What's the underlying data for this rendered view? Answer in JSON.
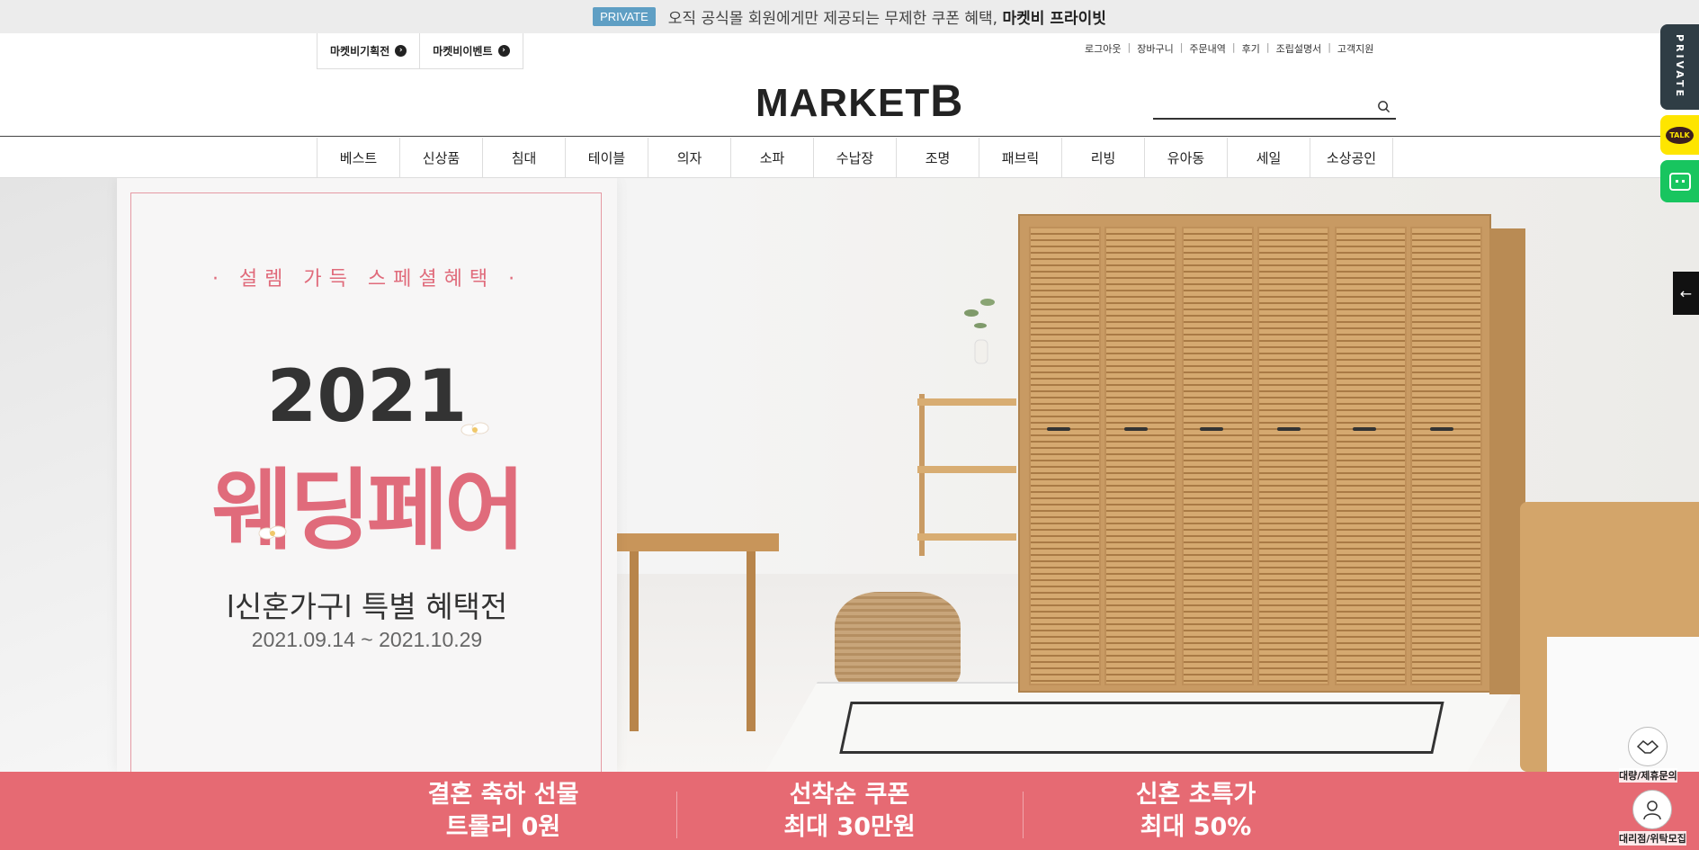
{
  "promo": {
    "badge": "PRIVATE",
    "text": "오직 공식몰 회원에게만 제공되는 무제한 쿠폰 혜택,",
    "brand": "마켓비 프라이빗"
  },
  "event_tabs": [
    {
      "label": "마켓비기획전",
      "icon": "arrow-right-circle-icon"
    },
    {
      "label": "마켓비이벤트",
      "icon": "arrow-right-circle-icon"
    }
  ],
  "util_links": [
    "로그아웃",
    "장바구니",
    "주문내역",
    "후기",
    "조립설명서",
    "고객지원"
  ],
  "logo": {
    "text": "MARKET",
    "suffix": "B"
  },
  "search": {
    "placeholder": "",
    "icon": "search-icon"
  },
  "nav": [
    "베스트",
    "신상품",
    "침대",
    "테이블",
    "의자",
    "소파",
    "수납장",
    "조명",
    "패브릭",
    "리빙",
    "유아동",
    "세일",
    "소상공인"
  ],
  "hero": {
    "subtitle": "· 설렘 가득 스페셜혜택 ·",
    "year": "2021",
    "title": "웨딩페어",
    "headline": "l신혼가구l 특별 혜택전",
    "dates": "2021.09.14 ~ 2021.10.29"
  },
  "benefits": [
    {
      "line1": "결혼 축하 선물",
      "line2": "트롤리 0원"
    },
    {
      "line1": "선착순 쿠폰",
      "line2": "최대 30만원"
    },
    {
      "line1": "신혼 초특가",
      "line2": "최대 50%"
    }
  ],
  "side": {
    "private": "PRIVATE",
    "talk": "TALK",
    "chat_icon": "chat-icon",
    "arrow": "←",
    "bulk_label": "대량/제휴문의",
    "agency_label": "대리점/위탁모집"
  },
  "colors": {
    "accent": "#e66a73",
    "badge": "#5f9fc4",
    "kakao": "#fee500",
    "chat": "#18c55f"
  }
}
